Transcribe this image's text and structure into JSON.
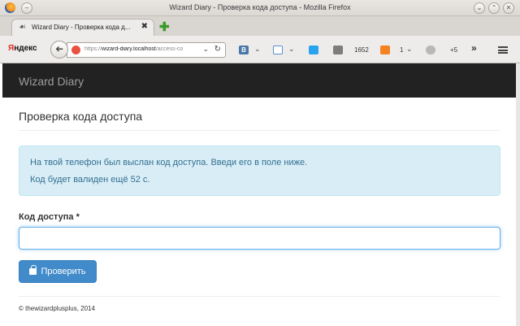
{
  "window": {
    "title": "Wizard Diary - Проверка кода доступа - Mozilla Firefox",
    "minimize_symbol": "⌄",
    "maximize_symbol": "⌃",
    "close_symbol": "✕",
    "left_button_symbol": "–"
  },
  "tab": {
    "icon_symbol": "☙",
    "title": "Wizard Diary - Проверка кода д...",
    "close_symbol": "✖",
    "new_tab_symbol": "✚"
  },
  "toolbar": {
    "yandex_first": "Я",
    "yandex_rest": "ндекс",
    "back_symbol": "➜",
    "url_prefix": "https://",
    "url_host": "wizard-diary.localhost",
    "url_path": "/access-co",
    "url_dropdown_symbol": "⌄",
    "reload_symbol": "↻",
    "vk_label": "В",
    "mail_count": "1652",
    "ok_count": "1",
    "weather_temp": "+5",
    "overflow_symbol": "»",
    "chevron_symbol": "⌄"
  },
  "app": {
    "brand": "Wizard Diary"
  },
  "main": {
    "page_title": "Проверка кода доступа",
    "alert_line1": "На твой телефон был выслан код доступа. Введи его в поле ниже.",
    "alert_line2": "Код будет валиден ещё 52 с.",
    "field_label": "Код доступа *",
    "field_value": "",
    "submit_label": "Проверить",
    "footer": "© thewizardplusplus, 2014"
  },
  "colors": {
    "navbar_bg": "#222222",
    "alert_bg": "#d9edf7",
    "alert_text": "#31708f",
    "primary": "#428bca"
  }
}
